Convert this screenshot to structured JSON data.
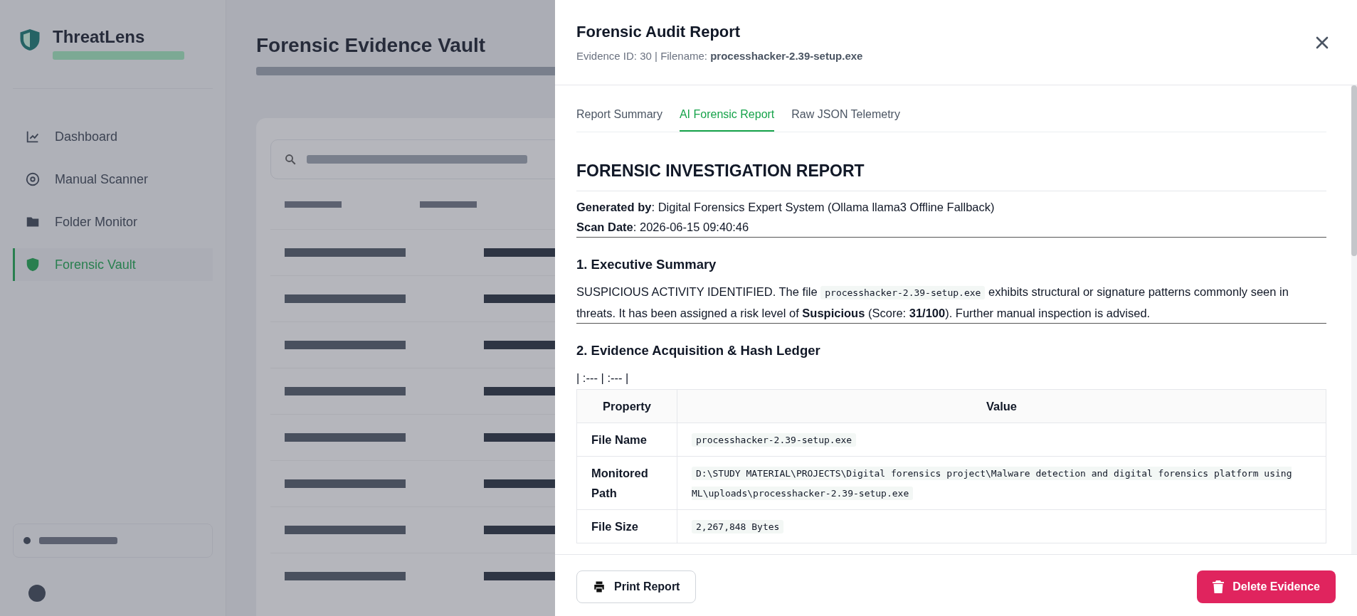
{
  "app": {
    "name": "ThreatLens"
  },
  "sidebar": {
    "items": [
      {
        "label": "Dashboard",
        "selected": false
      },
      {
        "label": "Manual Scanner",
        "selected": false
      },
      {
        "label": "Folder Monitor",
        "selected": false
      },
      {
        "label": "Forensic Vault",
        "selected": true
      }
    ]
  },
  "page": {
    "title": "Forensic Evidence Vault"
  },
  "modal": {
    "title": "Forensic Audit Report",
    "subtitle": "Evidence ID: 30 | Filename: **processhacker-2.39-setup.exe**",
    "tabs": [
      {
        "label": "Report Summary",
        "selected": false
      },
      {
        "label": "AI Forensic Report",
        "selected": true
      },
      {
        "label": "Raw JSON Telemetry",
        "selected": false
      }
    ],
    "report": [
      {
        "kind": "title",
        "text": "FORENSIC INVESTIGATION REPORT"
      },
      {
        "kind": "meta",
        "lines": [
          "**Generated by**: Digital Forensics Expert System (Ollama llama3 Offline Fallback)",
          "**Scan Date**: 2026-06-15 09:40:46"
        ]
      },
      {
        "kind": "heading",
        "text": "1. Executive Summary"
      },
      {
        "kind": "paragraph",
        "parts": [
          {
            "kind": "text",
            "text": "SUSPICIOUS ACTIVITY IDENTIFIED. The file "
          },
          {
            "kind": "code",
            "text": "processhacker-2.39-setup.exe"
          },
          {
            "kind": "text",
            "text": " exhibits structural or signature patterns commonly seen in threats. It has been assigned a risk level of **Suspicious** (Score: **31/100**). Further manual inspection is advised."
          }
        ]
      },
      {
        "kind": "heading",
        "text": "2. Evidence Acquisition & Hash Ledger"
      },
      {
        "kind": "raw",
        "text": "| :--- | :--- |"
      },
      {
        "kind": "table",
        "columns": [
          "Property",
          "Value"
        ],
        "rows": [
          {
            "property": "File Name",
            "value": "processhacker-2.39-setup.exe"
          },
          {
            "property": "Monitored Path",
            "value": "D:\\STUDY MATERIAL\\PROJECTS\\Digital forensics project\\Malware detection and digital forensics platform using ML\\uploads\\processhacker-2.39-setup.exe"
          },
          {
            "property": "File Size",
            "value": "2,267,848 Bytes"
          }
        ]
      }
    ],
    "buttons": [
      {
        "label": "Print Report",
        "kind": "print"
      },
      {
        "label": "Delete Evidence",
        "kind": "delete"
      }
    ]
  }
}
